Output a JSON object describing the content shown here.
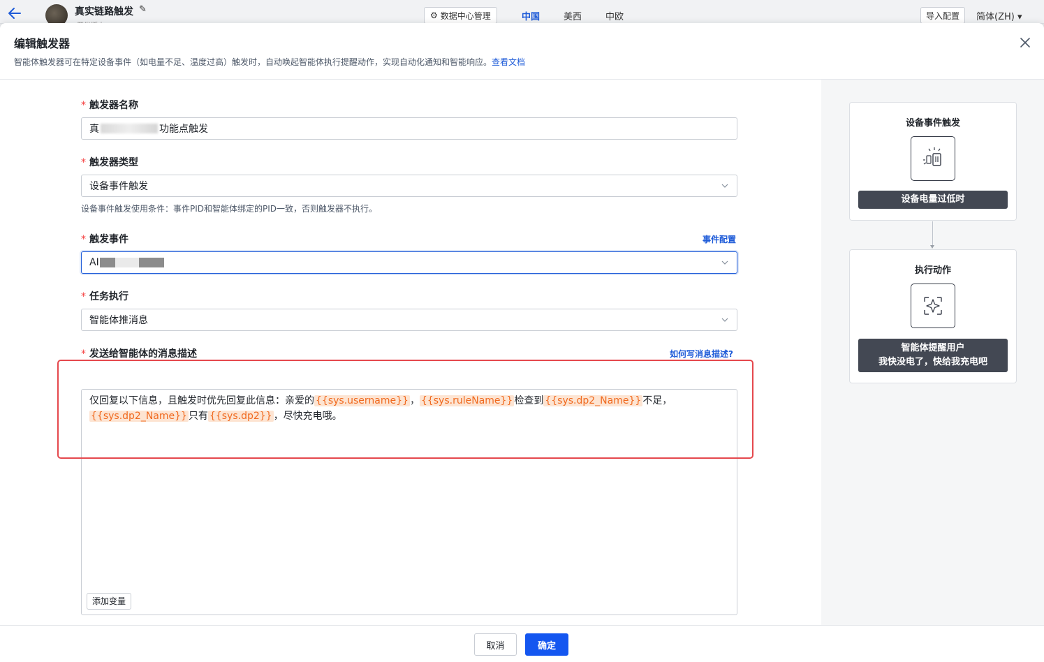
{
  "topbar": {
    "project_title": "真实链路触发",
    "project_subtitle": "开发版本",
    "data_center_button": "数据中心管理",
    "regions": [
      "中国",
      "美西",
      "中欧"
    ],
    "active_region": "中国",
    "import_button": "导入配置",
    "language": "简体(ZH)"
  },
  "modal": {
    "title": "编辑触发器",
    "description": "智能体触发器可在特定设备事件（如电量不足、温度过高）触发时，自动唤起智能体执行提醒动作，实现自动化通知和智能响应。",
    "doc_link": "查看文档"
  },
  "form": {
    "required_mark": "*",
    "name": {
      "label": "触发器名称",
      "value_prefix": "真",
      "value_suffix": "功能点触发"
    },
    "type": {
      "label": "触发器类型",
      "value": "设备事件触发",
      "hint": "设备事件触发使用条件：事件PID和智能体绑定的PID一致，否则触发器不执行。"
    },
    "event": {
      "label": "触发事件",
      "config_link": "事件配置",
      "value_prefix": "AI"
    },
    "task": {
      "label": "任务执行",
      "value": "智能体推消息"
    },
    "message": {
      "label": "发送给智能体的消息描述",
      "help_link": "如何写消息描述?",
      "segments": [
        {
          "text": "仅回复以下信息，且触发时优先回复此信息：亲爱的",
          "var": false
        },
        {
          "text": "{{sys.username}}",
          "var": true
        },
        {
          "text": "，",
          "var": false
        },
        {
          "text": "{{sys.ruleName}}",
          "var": true
        },
        {
          "text": "检查到",
          "var": false
        },
        {
          "text": "{{sys.dp2_Name}}",
          "var": true
        },
        {
          "text": "不足，",
          "var": false
        },
        {
          "text": "{{sys.dp2_Name}}",
          "var": true
        },
        {
          "text": "只有",
          "var": false
        },
        {
          "text": "{{sys.dp2}}",
          "var": true
        },
        {
          "text": "，尽快充电哦。",
          "var": false
        }
      ],
      "add_variable_button": "添加变量"
    }
  },
  "preview": {
    "trigger_card": {
      "title": "设备事件触发",
      "icon": "device-alert-icon",
      "bar_text": "设备电量过低时"
    },
    "action_card": {
      "title": "执行动作",
      "icon": "ai-sparkle-icon",
      "bar_text": "智能体提醒用户\n我快没电了，快给我充电吧"
    }
  },
  "footer": {
    "cancel": "取消",
    "confirm": "确定"
  },
  "colors": {
    "primary": "#1456f0",
    "link": "#1e5bd8",
    "required": "#f53f3f",
    "variable_text": "#f06a1f",
    "variable_bg": "#fde4d2",
    "highlight_border": "#e5484d",
    "preview_bar": "#434853"
  }
}
